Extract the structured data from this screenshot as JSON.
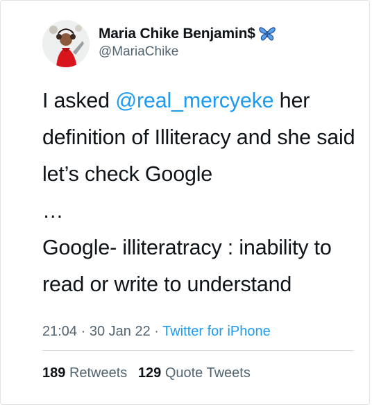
{
  "user": {
    "display_name": "Maria Chike Benjamin$",
    "badge_icon": "butterfly-icon",
    "handle": "@MariaChike"
  },
  "tweet": {
    "line1_before": "I asked ",
    "mention": "@real_mercyeke",
    "line1_after": " her definition of Illiteracy and she said let’s check Google",
    "ellipsis": "…",
    "definition": "Google- illiteratracy : inability to read or write to understand"
  },
  "meta": {
    "time": "21:04",
    "separator1": " · ",
    "date": "30 Jan 22",
    "separator2": " · ",
    "source": "Twitter for iPhone"
  },
  "stats": {
    "retweets_count": "189",
    "retweets_label": "Retweets",
    "quotes_count": "129",
    "quotes_label": "Quote Tweets"
  },
  "colors": {
    "link": "#1d9bf0",
    "secondary_text": "#536471",
    "primary_text": "#0f1419",
    "butterfly": "#1d6fd1"
  }
}
